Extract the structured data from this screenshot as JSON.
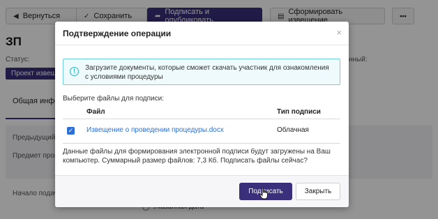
{
  "toolbar": {
    "back_label": "Вернуться",
    "save_label": "Сохранить",
    "sign_publish_label": "Подписать и опубликовать",
    "notice_label": "Сформировать извещение",
    "more_label": "•••"
  },
  "page": {
    "title": "ЗП",
    "status_label": "Статус:",
    "status_value": "Проект извещения",
    "right_fragment": "нный:",
    "tab_general": "Общая информация",
    "field_previous": "Предыдущий",
    "field_subject": "Предмет процедуры",
    "field_start": "Начало подачи",
    "radio_specified_date": "Указанная дата"
  },
  "modal": {
    "title": "Подтверждение операции",
    "close": "×",
    "info_text": "Загрузите документы, которые сможет скачать участник для ознакомления с условиями процедуры",
    "choose_label": "Выберите файлы для подписи:",
    "columns": {
      "file": "Файл",
      "sign_type": "Тип подписи"
    },
    "files": [
      {
        "name": "Извещение о проведении процедуры.docx",
        "sign_type": "Облачная",
        "checked": true
      }
    ],
    "note": "Данные файлы для формирования электронной подписи будут загружены на Ваш компьютер. Суммарный размер файлов: 7,3 Кб. Подписать файлы сейчас?",
    "sign_button": "Подписать",
    "close_button": "Закрыть"
  },
  "colors": {
    "accent": "#3a2f7a",
    "link": "#2e6fd6",
    "info_border": "#6fd0dc"
  }
}
